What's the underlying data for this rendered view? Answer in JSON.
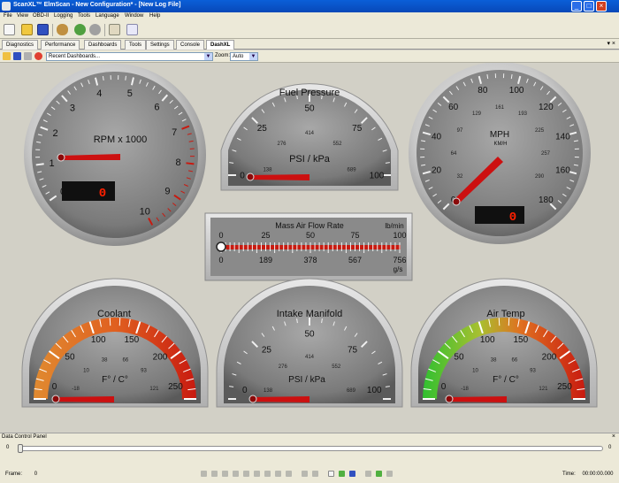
{
  "window": {
    "title": "ScanXL™ ElmScan - New Configuration* - [New Log File]",
    "buttons": [
      "_",
      "□",
      "×"
    ]
  },
  "menu": [
    "File",
    "View",
    "OBD-II",
    "Logging",
    "Tools",
    "Language",
    "Window",
    "Help"
  ],
  "toolbar_icons": [
    "new-icon",
    "open-icon",
    "save-icon",
    "car-icon",
    "connect-icon",
    "disconnect-icon",
    "settings-icon",
    "about-icon"
  ],
  "tabs": {
    "items": [
      "Diagnostics",
      "Performance",
      "Dashboards",
      "Tools",
      "Settings",
      "Console",
      "DashXL"
    ],
    "active": "DashXL",
    "controls": "▾ ×"
  },
  "dashbar": {
    "dashboard_select": "Recent Dashboards...",
    "zoom_label": "Zoom:",
    "zoom_value": "Auto"
  },
  "gauges": {
    "rpm": {
      "label": "RPM x 1000",
      "ticks": [
        "0",
        "1",
        "2",
        "3",
        "4",
        "5",
        "6",
        "7",
        "8",
        "9",
        "10"
      ],
      "digital": "0"
    },
    "fuel": {
      "title": "Fuel Pressure",
      "unit": "PSI / kPa",
      "outer": [
        "0",
        "25",
        "50",
        "75",
        "100"
      ],
      "inner": [
        "138",
        "276",
        "414",
        "552",
        "689"
      ]
    },
    "mph": {
      "label": "MPH",
      "sub": "KM/H",
      "ticks": [
        "0",
        "20",
        "40",
        "60",
        "80",
        "100",
        "120",
        "140",
        "160",
        "180"
      ],
      "inner": [
        "32",
        "64",
        "97",
        "129",
        "161",
        "193",
        "225",
        "257",
        "290"
      ],
      "digital": "0"
    },
    "maf": {
      "title": "Mass Air Flow Rate",
      "unit_top": "lb/min",
      "unit_bottom": "g/s",
      "top": [
        "0",
        "25",
        "50",
        "75",
        "100"
      ],
      "bottom": [
        "0",
        "189",
        "378",
        "567",
        "756"
      ]
    },
    "coolant": {
      "title": "Coolant",
      "unit": "F° / C°",
      "outer": [
        "0",
        "50",
        "100",
        "150",
        "200",
        "250"
      ],
      "inner": [
        "-18",
        "10",
        "38",
        "66",
        "93",
        "121"
      ]
    },
    "intake": {
      "title": "Intake Manifold",
      "unit": "PSI / kPa",
      "outer": [
        "0",
        "25",
        "50",
        "75",
        "100"
      ],
      "inner": [
        "138",
        "276",
        "414",
        "552",
        "689"
      ]
    },
    "airtemp": {
      "title": "Air Temp",
      "unit": "F° / C°",
      "outer": [
        "0",
        "50",
        "100",
        "150",
        "200",
        "250"
      ],
      "inner": [
        "-18",
        "10",
        "38",
        "66",
        "93",
        "121"
      ]
    }
  },
  "data_panel": {
    "title": "Data Control Panel",
    "close": "×",
    "slider_min": "0",
    "slider_max": "0",
    "frame_label": "Frame:",
    "frame_value": "0",
    "time_label": "Time:",
    "time_value": "00:00:00.000"
  },
  "colors": {
    "needle": "#cc1010",
    "redline": "#d42020",
    "coolant_arc_start": "#e07020",
    "coolant_arc_end": "#c81a10",
    "airtemp_arc_start": "#30c030",
    "airtemp_arc_end": "#c81a10",
    "digital_bg": "#101010",
    "digital_fg": "#ff2000"
  }
}
